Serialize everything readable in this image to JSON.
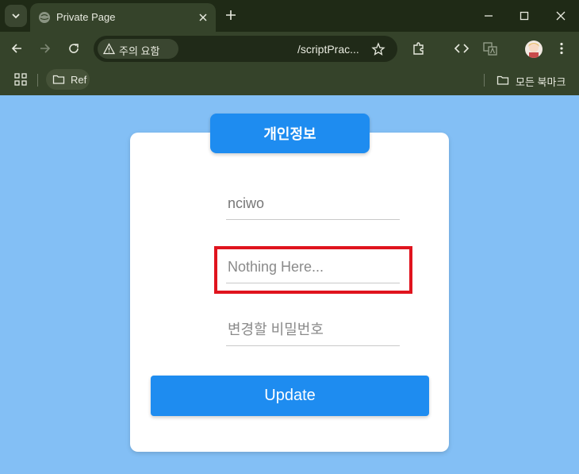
{
  "browser": {
    "tab_title": "Private Page",
    "security_chip": "주의 요함",
    "url": "/scriptPrac...",
    "bookmark_folder": "Ref",
    "all_bookmarks": "모든 북마크"
  },
  "page": {
    "heading": "개인정보",
    "fields": {
      "username_value": "nciwo",
      "second_placeholder": "Nothing Here...",
      "new_password_placeholder": "변경할 비밀번호"
    },
    "update_button": "Update"
  },
  "colors": {
    "page_background": "#83bff5",
    "accent": "#1e8cf0",
    "highlight": "#e0141e"
  }
}
